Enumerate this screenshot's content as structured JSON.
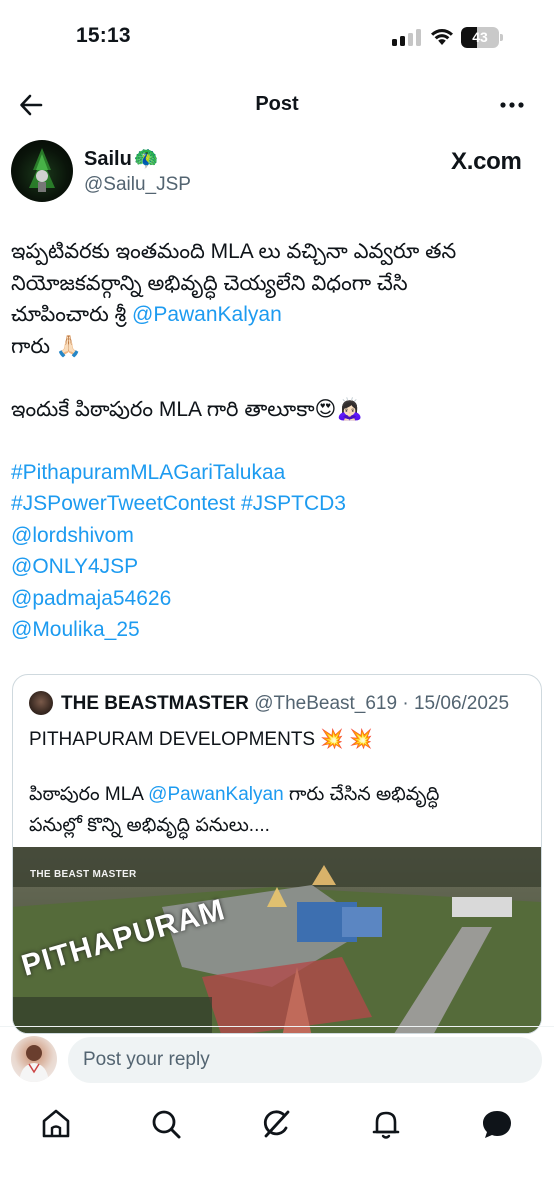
{
  "status_bar": {
    "time": "15:13",
    "battery": "43",
    "battery_fraction": 0.43
  },
  "header": {
    "title": "Post"
  },
  "author": {
    "display_name": "Sailu",
    "name_emoji": "🦚",
    "handle": "@Sailu_JSP",
    "source": "X.com"
  },
  "tweet": {
    "line1": "ఇప్పటివరకు ఇంతమంది MLA లు వచ్చినా ఎవ్వరూ తన",
    "line2": "నియోజకవర్గాన్ని అభివృద్ధి చెయ్యలేని విధంగా చేసి",
    "line3_text": "చూపించారు శ్రీ ",
    "line3_mention": "@PawanKalyan",
    "line4": "గారు 🙏🏻",
    "line5": "ఇందుకే పిఠాపురం MLA గారి తాలూకా😍🙇🏻‍♀️",
    "hashtag1": "#PithapuramMLAGariTalukaa",
    "hashtag2": "#JSPowerTweetContest",
    "hashtag3": "#JSPTCD3",
    "mention1": "@lordshivom",
    "mention2": "@ONLY4JSP",
    "mention3": "@padmaja54626",
    "mention4": "@Moulika_25"
  },
  "quote": {
    "name": "THE BEASTMASTER",
    "handle": "@TheBeast_619",
    "date": "15/06/2025",
    "title": "PITHAPURAM DEVELOPMENTS 💥 💥",
    "text_line1_a": "పిఠాపురం MLA ",
    "text_line1_mention": "@PawanKalyan",
    "text_line1_b": " గారు చేసిన అభివృద్ధి",
    "text_line2": "పనుల్లో కొన్ని అభివృద్ధి పనులు....",
    "media_watermark": "THE BEAST MASTER",
    "media_caption": "PITHAPURAM"
  },
  "reply": {
    "placeholder": "Post your reply"
  },
  "nav": {
    "items": [
      "home-icon",
      "search-icon",
      "grok-icon",
      "notifications-icon",
      "messages-icon"
    ]
  }
}
